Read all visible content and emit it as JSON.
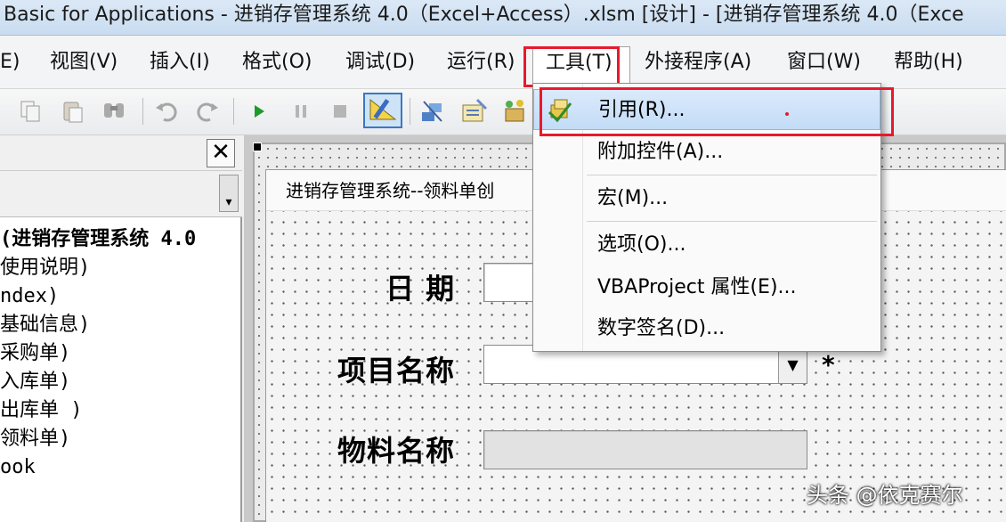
{
  "window": {
    "title": "Basic for Applications - 进销存管理系统 4.0（Excel+Access）.xlsm [设计] - [进销存管理系统 4.0（Exce"
  },
  "menubar": {
    "items": [
      {
        "label": "E)"
      },
      {
        "label": "视图(V)"
      },
      {
        "label": "插入(I)"
      },
      {
        "label": "格式(O)"
      },
      {
        "label": "调试(D)"
      },
      {
        "label": "运行(R)"
      },
      {
        "label": "工具(T)"
      },
      {
        "label": "外接程序(A)"
      },
      {
        "label": "窗口(W)"
      },
      {
        "label": "帮助(H)"
      }
    ]
  },
  "toolbar": {
    "icons": [
      "copy-icon",
      "paste-icon",
      "find-icon",
      "undo-icon",
      "redo-icon",
      "run-icon",
      "pause-icon",
      "stop-icon",
      "design-mode-icon",
      "project-explorer-icon",
      "properties-icon",
      "object-browser-icon"
    ]
  },
  "project_pane": {
    "close_glyph": "✕",
    "tree": [
      "(进销存管理系统 4.0",
      "使用说明)",
      "ndex)",
      "基础信息)",
      "采购单)",
      "入库单)",
      "出库单 )",
      "领料单)",
      "ook"
    ]
  },
  "form": {
    "caption": "进销存管理系统--领料单创",
    "labels": {
      "date": "日 期",
      "project": "项目名称",
      "material": "物料名称",
      "required_mark": "*"
    }
  },
  "tools_menu": {
    "items": [
      {
        "label": "引用(R)..."
      },
      {
        "label": "附加控件(A)..."
      },
      {
        "label": "宏(M)..."
      },
      {
        "label": "选项(O)..."
      },
      {
        "label": "VBAProject 属性(E)..."
      },
      {
        "label": "数字签名(D)..."
      }
    ]
  },
  "watermark": "头条 @依克赛尔",
  "colors": {
    "highlight_box": "#e8192c",
    "menu_highlight": "#c3dcf7"
  }
}
